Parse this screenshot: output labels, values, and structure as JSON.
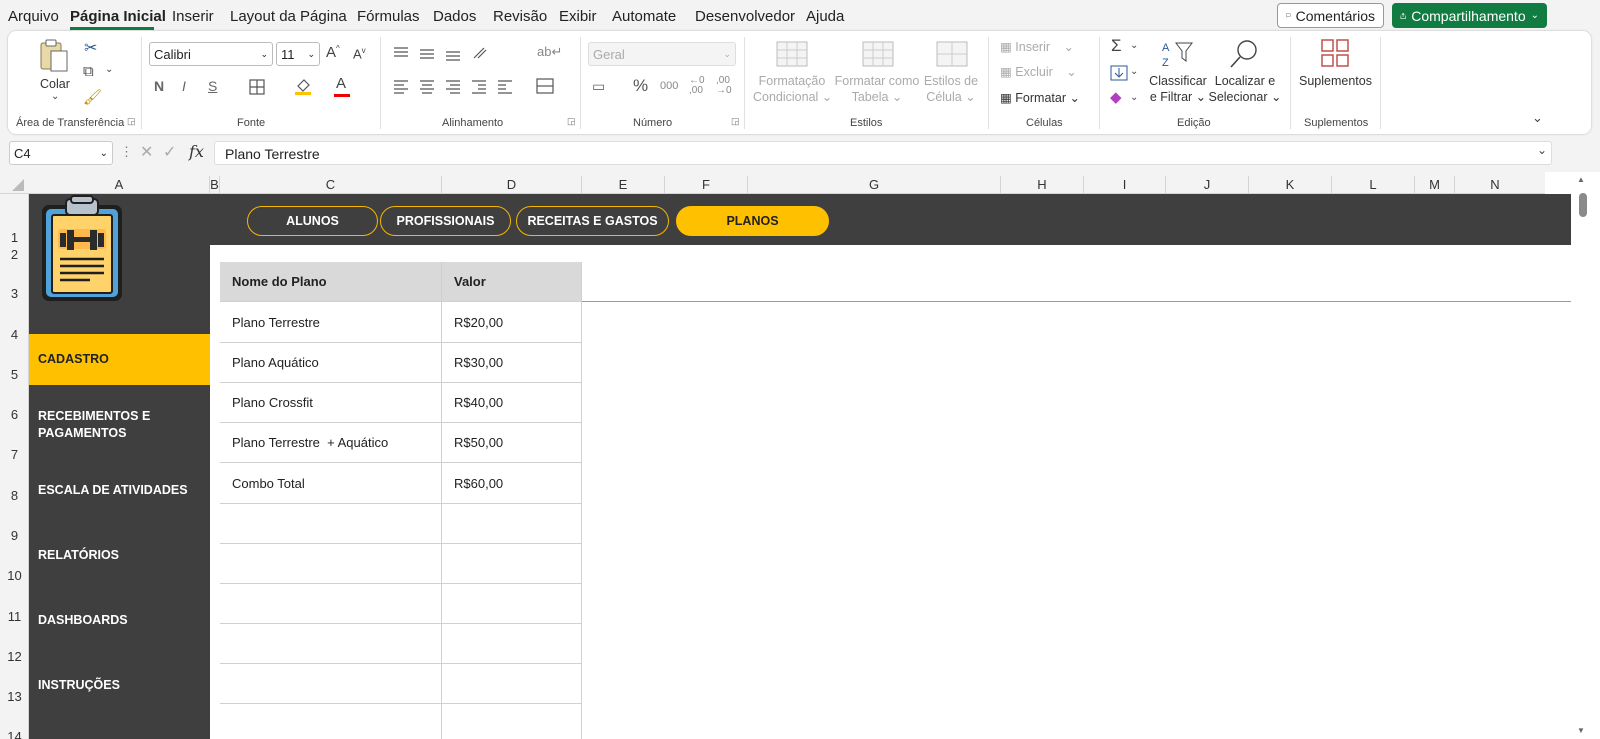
{
  "menu": {
    "items": [
      "Arquivo",
      "Página Inicial",
      "Inserir",
      "Layout da Página",
      "Fórmulas",
      "Dados",
      "Revisão",
      "Exibir",
      "Automate",
      "Desenvolvedor",
      "Ajuda"
    ],
    "comments": "Comentários",
    "share": "Compartilhamento"
  },
  "ribbon": {
    "clipboard": {
      "paste": "Colar",
      "label": "Área de Transferência"
    },
    "font": {
      "name": "Calibri",
      "size": "11",
      "bold": "N",
      "italic": "I",
      "underline": "S",
      "label": "Fonte"
    },
    "alignment": {
      "label": "Alinhamento"
    },
    "number": {
      "format": "Geral",
      "label": "Número"
    },
    "styles": {
      "conditional1": "Formatação",
      "conditional2": "Condicional",
      "table1": "Formatar como",
      "table2": "Tabela",
      "cell1": "Estilos de",
      "cell2": "Célula",
      "label": "Estilos"
    },
    "cells": {
      "insert": "Inserir",
      "delete": "Excluir",
      "format": "Formatar",
      "label": "Células"
    },
    "editing": {
      "sort1": "Classificar",
      "sort2": "e Filtrar",
      "find1": "Localizar e",
      "find2": "Selecionar",
      "label": "Edição"
    },
    "addins": {
      "button": "Suplementos",
      "label": "Suplementos"
    }
  },
  "formula_bar": {
    "cell_ref": "C4",
    "fx": "fx",
    "content": "Plano Terrestre"
  },
  "columns": [
    "A",
    "B",
    "C",
    "D",
    "E",
    "F",
    "G",
    "H",
    "I",
    "J",
    "K",
    "L",
    "M",
    "N"
  ],
  "rows": [
    "1",
    "2",
    "3",
    "4",
    "5",
    "6",
    "7",
    "8",
    "9",
    "10",
    "11",
    "12",
    "13",
    "14"
  ],
  "nav_tabs": [
    "ALUNOS",
    "PROFISSIONAIS",
    "RECEITAS E GASTOS",
    "PLANOS"
  ],
  "sidebar": [
    "CADASTRO",
    "RECEBIMENTOS E PAGAMENTOS",
    "ESCALA DE ATIVIDADES",
    "RELATÓRIOS",
    "DASHBOARDS",
    "INSTRUÇÕES"
  ],
  "table": {
    "headers": [
      "Nome do Plano",
      "Valor"
    ],
    "rows": [
      [
        "Plano Terrestre",
        "R$20,00"
      ],
      [
        "Plano Aquático",
        "R$30,00"
      ],
      [
        "Plano Crossfit",
        "R$40,00"
      ],
      [
        "Plano Terrestre  + Aquático",
        "R$50,00"
      ],
      [
        "Combo Total",
        "R$60,00"
      ]
    ]
  },
  "colors": {
    "accent": "#ffc000",
    "panel": "#3f3f3f",
    "excel_green": "#107c41"
  }
}
